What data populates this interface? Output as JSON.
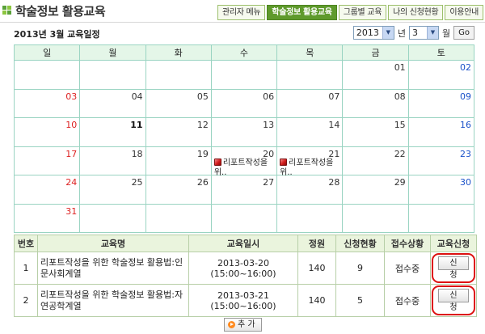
{
  "header": {
    "title": "학술정보 활용교육",
    "tabs": [
      "관리자 메뉴",
      "학술정보 활용교육",
      "그룹별 교육",
      "나의 신청현황",
      "이용안내"
    ],
    "active_tab": "학술정보 활용교육"
  },
  "calendar": {
    "heading": "2013년 3월 교육일정",
    "year": "2013",
    "year_suffix": "년",
    "month": "3",
    "month_suffix": "월",
    "go_label": "Go",
    "weekdays": [
      "일",
      "월",
      "화",
      "수",
      "목",
      "금",
      "토"
    ],
    "weeks": [
      [
        "",
        "",
        "",
        "",
        "",
        "01",
        "02"
      ],
      [
        "03",
        "04",
        "05",
        "06",
        "07",
        "08",
        "09"
      ],
      [
        "10",
        "11",
        "12",
        "13",
        "14",
        "15",
        "16"
      ],
      [
        "17",
        "18",
        "19",
        "20",
        "21",
        "22",
        "23"
      ],
      [
        "24",
        "25",
        "26",
        "27",
        "28",
        "29",
        "30"
      ],
      [
        "31",
        "",
        "",
        "",
        "",
        "",
        ""
      ]
    ],
    "today": "11",
    "events": [
      {
        "day": "20",
        "label": "리포트작성을 위.."
      },
      {
        "day": "21",
        "label": "리포트작성을 위.."
      }
    ]
  },
  "education": {
    "columns": [
      "번호",
      "교육명",
      "교육일시",
      "정원",
      "신청현황",
      "접수상황",
      "교육신청"
    ],
    "rows": [
      {
        "no": "1",
        "name": "리포트작성을 위한 학술정보 활용법:인문사회계열",
        "date": "2013-03-20 (15:00~16:00)",
        "capacity": "140",
        "applied": "9",
        "status": "접수중",
        "action": "신청"
      },
      {
        "no": "2",
        "name": "리포트작성을 위한 학술정보 활용법:자연공학계열",
        "date": "2013-03-21 (15:00~16:00)",
        "capacity": "140",
        "applied": "5",
        "status": "접수중",
        "action": "신청"
      }
    ],
    "add_label": "추 가"
  },
  "colors": {
    "accent": "#5f9a2c",
    "sunday": "#dd2222",
    "saturday": "#1b52c9",
    "highlight": "#dd1111"
  }
}
